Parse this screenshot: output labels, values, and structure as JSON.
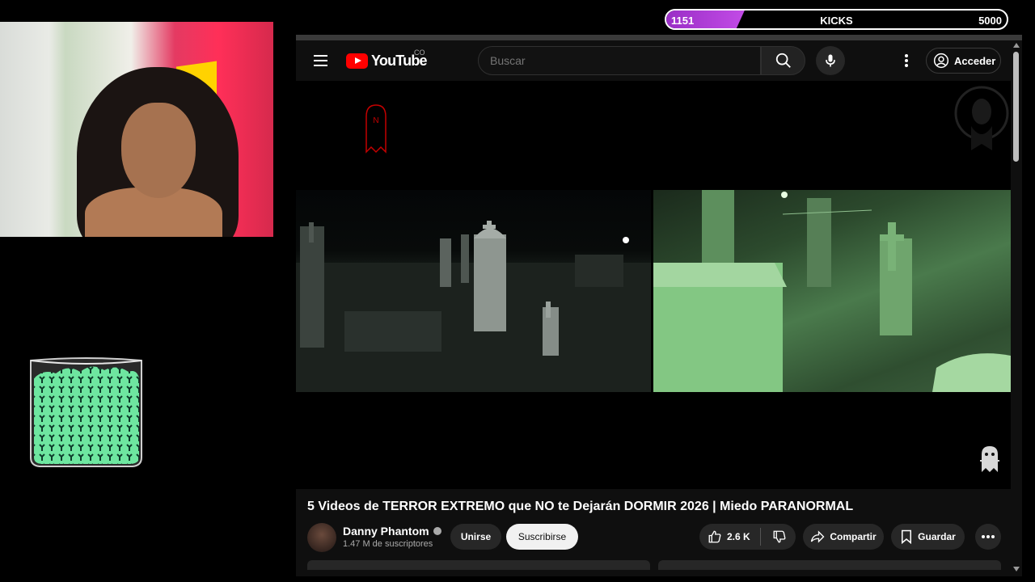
{
  "kicks": {
    "current": "1151",
    "label": "KICKS",
    "goal": "5000",
    "progress_fraction": 0.23
  },
  "youtube": {
    "logo_text": "YouTube",
    "country_code": "CO",
    "search_placeholder": "Buscar",
    "signin_label": "Acceder",
    "video": {
      "title": "5 Videos de TERROR EXTREMO que NO te Dejarán DORMIR 2026 | Miedo PARANORMAL",
      "channel_name": "Danny Phantom",
      "subscribers": "1.47 M de suscriptores",
      "join_label": "Unirse",
      "subscribe_label": "Suscribirse",
      "likes": "2.6 K",
      "share_label": "Compartir",
      "save_label": "Guardar"
    }
  },
  "colors": {
    "kicks_fill": "#b13fd8",
    "youtube_red": "#ff0000",
    "background": "#0f0f0f"
  },
  "icons": [
    "hamburger-menu-icon",
    "youtube-logo-icon",
    "search-icon",
    "mic-icon",
    "more-vertical-icon",
    "account-circle-icon",
    "like-icon",
    "dislike-icon",
    "share-icon",
    "save-icon",
    "more-horizontal-icon",
    "verified-icon",
    "ghost-icon"
  ]
}
